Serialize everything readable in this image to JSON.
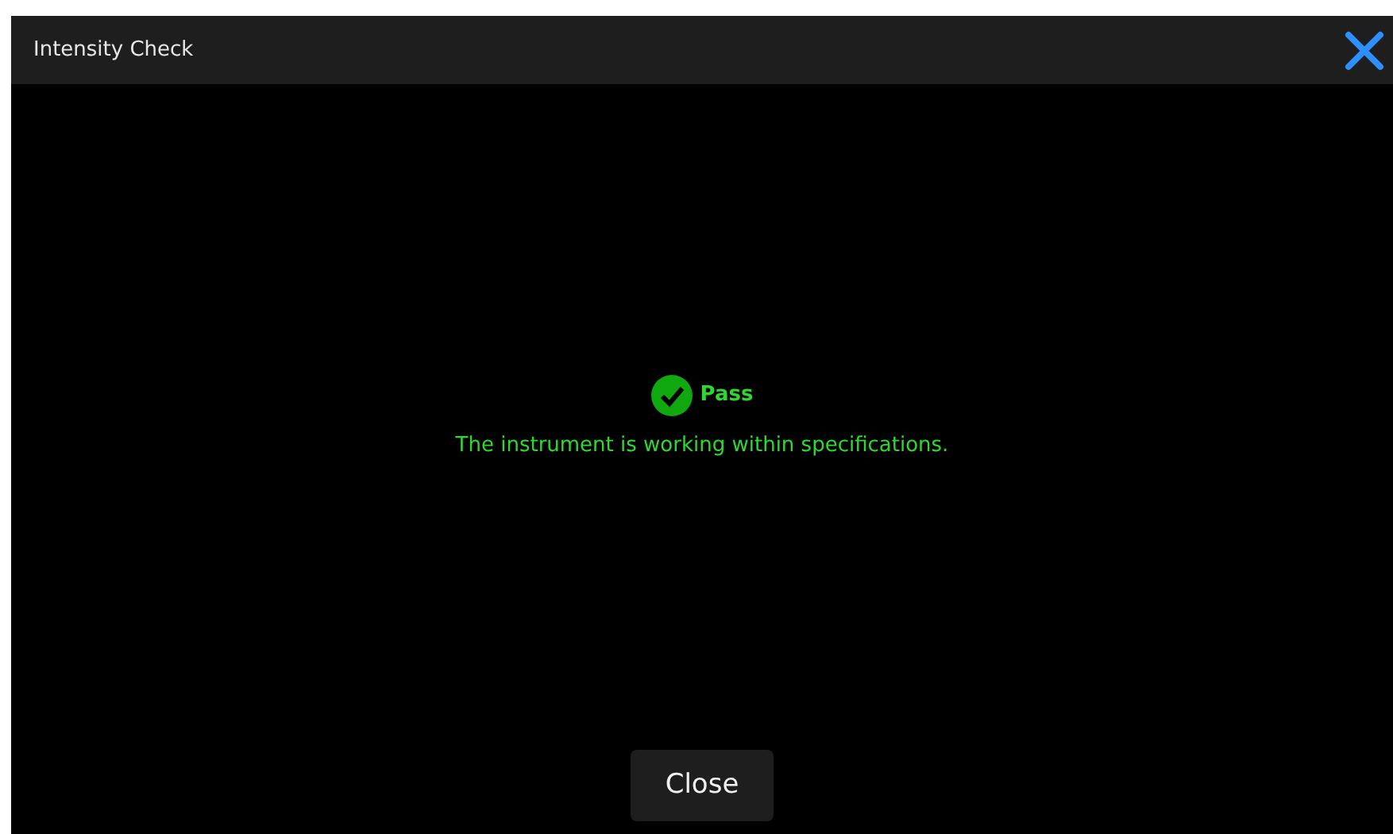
{
  "window": {
    "title": "Intensity Check"
  },
  "result": {
    "kind": "pass",
    "label": "Pass",
    "message": "The instrument is working within specifications."
  },
  "buttons": [
    {
      "label": "Close"
    }
  ]
}
